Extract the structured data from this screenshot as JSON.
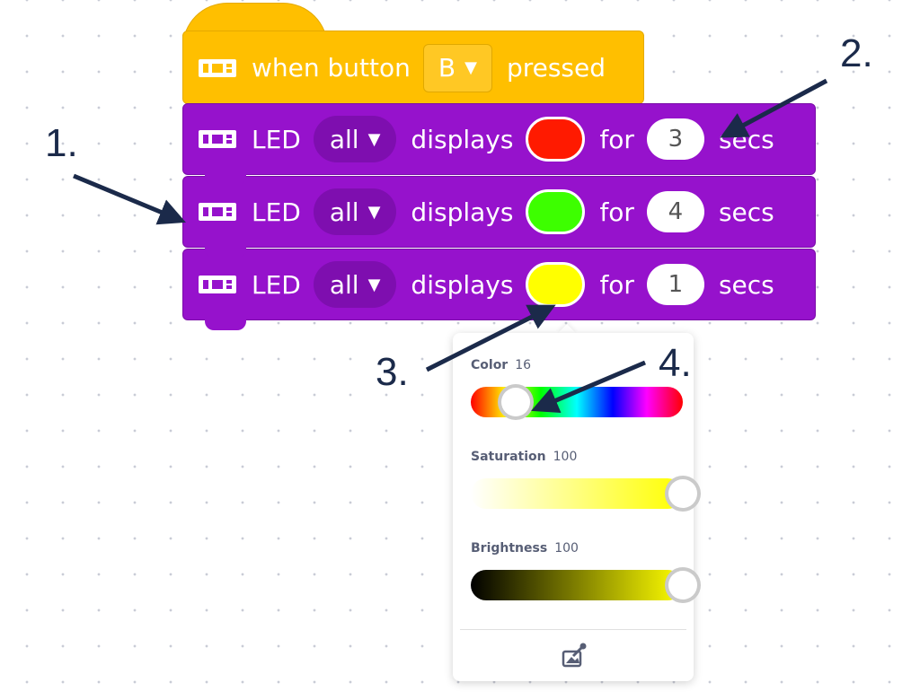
{
  "hat_block": {
    "prefix": "when button",
    "button_value": "B",
    "suffix": "pressed",
    "color": "#FFBF00"
  },
  "led_blocks": [
    {
      "led_label": "LED",
      "target": "all",
      "displays_label": "displays",
      "color": "#FF1A00",
      "for_label": "for",
      "duration": "3",
      "unit": "secs"
    },
    {
      "led_label": "LED",
      "target": "all",
      "displays_label": "displays",
      "color": "#3DFF00",
      "for_label": "for",
      "duration": "4",
      "unit": "secs"
    },
    {
      "led_label": "LED",
      "target": "all",
      "displays_label": "displays",
      "color": "#FFFF00",
      "for_label": "for",
      "duration": "1",
      "unit": "secs"
    }
  ],
  "block_color": "#9612CC",
  "color_picker": {
    "color_label": "Color",
    "color_value": "16",
    "saturation_label": "Saturation",
    "saturation_value": "100",
    "brightness_label": "Brightness",
    "brightness_value": "100",
    "color_level": 0.16,
    "saturation_level": 1.0,
    "brightness_level": 1.0,
    "eyedropper_icon": "eyedropper-icon"
  },
  "annotations": {
    "one": "1.",
    "two": "2.",
    "three": "3.",
    "four": "4."
  }
}
